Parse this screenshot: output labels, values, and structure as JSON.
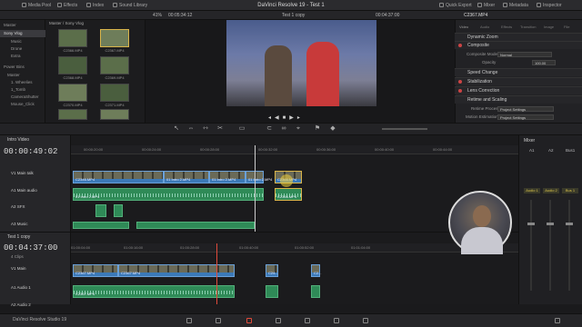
{
  "topbar": {
    "media_pool": "Media Pool",
    "effects": "Effects",
    "index": "Index",
    "sound_library": "Sound Library",
    "title": "DaVinci Resolve 19 - Test 1",
    "quick_export": "Quick Export",
    "mixer": "Mixer",
    "metadata": "Metadata",
    "inspector": "Inspector"
  },
  "subbar": {
    "zoom": "41%",
    "timecode_left": "00:05:34:12",
    "timeline_name": "Test 1 copy",
    "timecode_right": "00:04:37:00",
    "clip_name": "C2367.MP4"
  },
  "mediapool": {
    "items": [
      "Master",
      "Sony Vlog",
      "Music",
      "Drone",
      "Extra",
      "Power Bins",
      "Master",
      "1. Wheelies",
      "1_Tomb",
      "CameraShutter",
      "Mouse_Click"
    ],
    "bin_path": "Master / Sony Vlog",
    "clips": [
      "C2366.MP4",
      "C2367.MP4",
      "C2368.MP4",
      "C2369.MP4",
      "C2370.MP4",
      "C2371.MP4",
      "C2372.MP4",
      "C2373.MP4"
    ]
  },
  "inspector": {
    "tabs": [
      "Video",
      "Audio",
      "Effects",
      "Transition",
      "Image",
      "File"
    ],
    "dynamic_zoom": "Dynamic Zoom",
    "composite": "Composite",
    "composite_mode_label": "Composite Mode",
    "composite_mode_value": "Normal",
    "opacity_label": "Opacity",
    "opacity_value": "100.00",
    "speed_change": "Speed Change",
    "stabilization": "Stabilization",
    "lens_correction": "Lens Correction",
    "retime_scaling": "Retime and Scaling",
    "retime_process_label": "Retime Process",
    "retime_process_value": "Project Settings",
    "motion_estimation_label": "Motion Estimation",
    "motion_estimation_value": "Project Settings"
  },
  "timeline1": {
    "name": "Intro Video",
    "timecode": "00:00:49:02",
    "tracks": [
      "V1 Main talk",
      "A1 Main audio",
      "A2 SFX",
      "A3 Music"
    ],
    "ruler": [
      "00:00:20:00",
      "00:00:24:00",
      "00:00:28:00",
      "00:00:32:00",
      "00:00:36:00",
      "00:00:40:00",
      "00:00:44:00",
      "00:00:48:00",
      "00:00:52:00",
      "00:00:56:00"
    ],
    "clips_v": [
      "C2346.MP4",
      "01 Intro 2.MP4",
      "01 Intro 2.MP4",
      "01 Intro 2.MP4",
      "C2366.MP4"
    ],
    "clips_a": [
      "01 Intro 2.MP4",
      "C2366.MP4"
    ]
  },
  "timeline2": {
    "name": "Test 1 copy",
    "timecode": "00:04:37:00",
    "clip_count": "4 Clips",
    "tracks": [
      "V1 Main",
      "A1 Audio 1",
      "A2 Audio 2"
    ],
    "ruler": [
      "01:00:04:00",
      "01:00:16:00",
      "01:00:28:00",
      "01:00:40:00",
      "01:00:52:00",
      "01:01:04:00"
    ],
    "clips_v": [
      "C2367.MP4",
      "C2367.MP4",
      "C24...",
      "C2..."
    ],
    "clips_a": [
      "C2367.MP4"
    ]
  },
  "mixer": {
    "title": "Mixer",
    "channels": [
      "A1",
      "A2",
      "Bus1"
    ],
    "labels": [
      "Audio 1",
      "Audio 2",
      "Bus 1"
    ]
  },
  "bottombar": {
    "app": "DaVinci Resolve Studio 19"
  }
}
